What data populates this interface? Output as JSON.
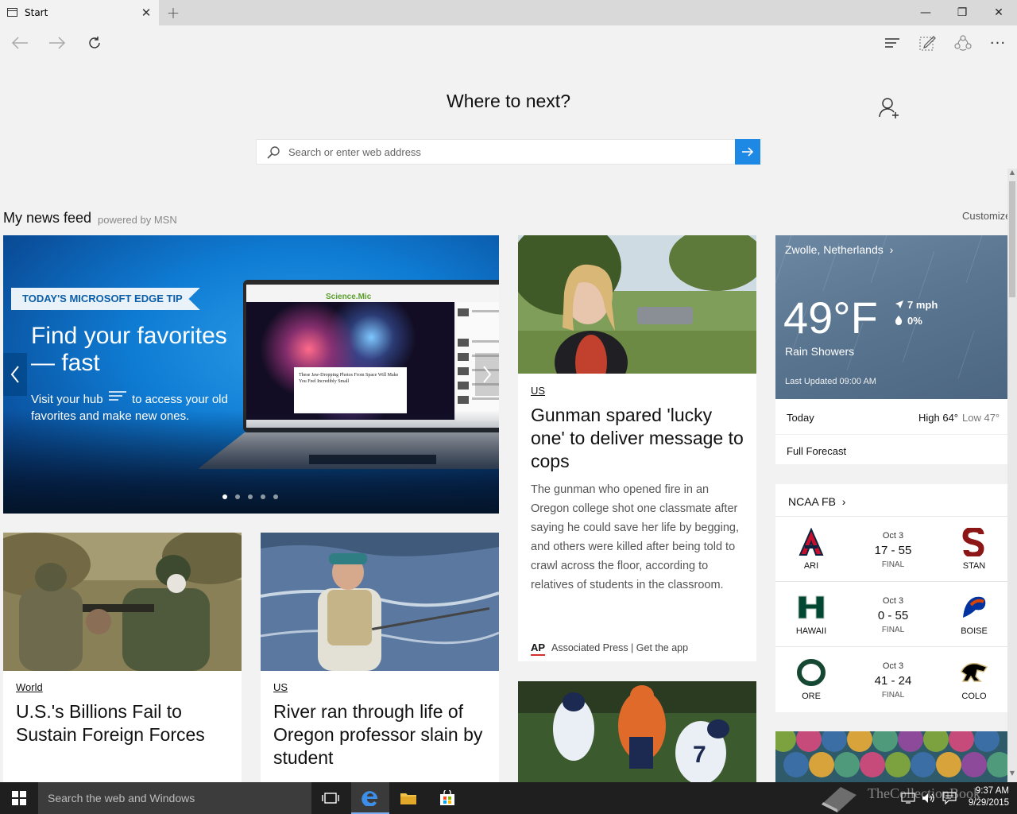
{
  "browser": {
    "tab_title": "Start",
    "new_tab_glyph": "+",
    "close_tab_glyph": "✕"
  },
  "window_controls": {
    "minimize": "—",
    "restore": "❐",
    "close": "✕"
  },
  "toolbar": {
    "back_icon": "back-arrow-icon",
    "forward_icon": "forward-arrow-icon",
    "refresh_icon": "refresh-icon",
    "hub_icon": "hub-icon",
    "note_icon": "web-note-icon",
    "share_icon": "share-icon",
    "more_glyph": "···"
  },
  "hero": {
    "title": "Where to next?",
    "search_placeholder": "Search or enter web address"
  },
  "feed": {
    "title": "My news feed",
    "powered_by": "powered by MSN",
    "customize": "Customize"
  },
  "carousel": {
    "badge": "TODAY'S MICROSOFT EDGE TIP",
    "headline": "Find your favorites — fast",
    "subtitle_before": "Visit your hub",
    "subtitle_after": "to access your old favorites and make new ones.",
    "slide_count": 5,
    "active_slide": 1,
    "laptop_site": "Science.Mic",
    "laptop_caption": "These Jaw-Dropping Photos From Space Will Make You Feel Incredibly Small"
  },
  "articles": [
    {
      "category": "US",
      "headline": "Gunman spared 'lucky one' to deliver message to cops",
      "summary": "The gunman who opened fire in an Oregon college shot one classmate after saying he could save her life by begging, and others were killed after being told to crawl across the floor, according to relatives of students in the classroom.",
      "source_logo": "AP",
      "source": "Associated Press | Get the app"
    },
    {
      "category": "World",
      "headline": "U.S.'s Billions Fail to Sustain Foreign Forces"
    },
    {
      "category": "US",
      "headline": "River ran through life of Oregon professor slain by student"
    }
  ],
  "weather": {
    "location": "Zwolle, Netherlands",
    "temperature": "49°F",
    "wind": "7 mph",
    "precip": "0%",
    "condition": "Rain Showers",
    "updated": "Last Updated 09:00 AM",
    "today_label": "Today",
    "high": "High 64°",
    "low": "Low 47°",
    "forecast_link": "Full Forecast",
    "colors": {
      "panel": "#5a7691"
    }
  },
  "ncaa": {
    "title": "NCAA FB",
    "games": [
      {
        "date": "Oct 3",
        "score": "17 - 55",
        "status": "FINAL",
        "home": "ARI",
        "away": "STAN",
        "home_color": "#c8102e",
        "away_color": "#8c1515"
      },
      {
        "date": "Oct 3",
        "score": "0 - 55",
        "status": "FINAL",
        "home": "HAWAII",
        "away": "BOISE",
        "home_color": "#024731",
        "away_color": "#0033a0"
      },
      {
        "date": "Oct 3",
        "score": "41 - 24",
        "status": "FINAL",
        "home": "ORE",
        "away": "COLO",
        "home_color": "#154733",
        "away_color": "#cfb87c"
      }
    ]
  },
  "taskbar": {
    "search_text": "Search the web and Windows",
    "time": "9:37 AM",
    "date": "9/29/2015",
    "watermark": "TheCollectionBook"
  },
  "colors": {
    "accent": "#1e88e5",
    "taskbar": "#1f1f1f",
    "edge_blue": "#0f7cd4"
  }
}
